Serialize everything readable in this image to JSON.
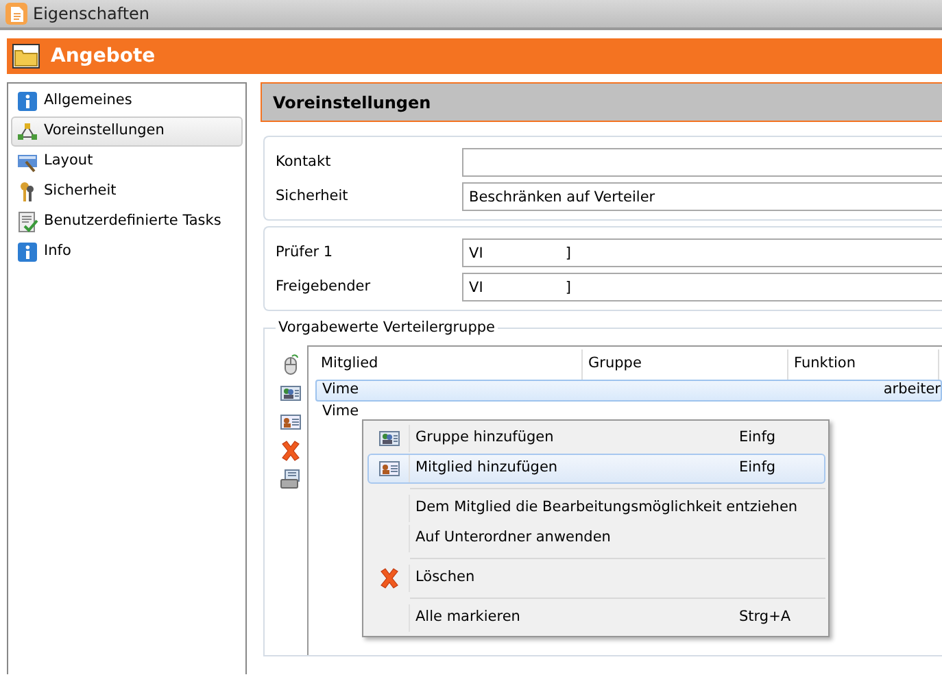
{
  "window": {
    "title": "Eigenschaften"
  },
  "header": {
    "title": "Angebote"
  },
  "sidebar": {
    "items": [
      {
        "label": "Allgemeines",
        "selected": false
      },
      {
        "label": "Voreinstellungen",
        "selected": true
      },
      {
        "label": "Layout",
        "selected": false
      },
      {
        "label": "Sicherheit",
        "selected": false
      },
      {
        "label": "Benutzerdefinierte Tasks",
        "selected": false
      },
      {
        "label": "Info",
        "selected": false
      }
    ]
  },
  "panel": {
    "title": "Voreinstellungen",
    "groups": [
      {
        "fields": [
          {
            "label": "Kontakt"
          },
          {
            "label": "Sicherheit",
            "value": "Beschränken auf Verteiler"
          }
        ]
      },
      {
        "fields": [
          {
            "label": "Prüfer 1",
            "value": "VI                  ]"
          },
          {
            "label": "Freigebender",
            "value": "VI                  ]"
          }
        ]
      }
    ],
    "distribution": {
      "legend": "Vorgabewerte Verteilergruppe",
      "table": {
        "columns": [
          "Mitglied",
          "Gruppe",
          "Funktion"
        ],
        "rows": [
          {
            "selected": true,
            "cells": [
              "Vime",
              "",
              "arbeiter"
            ]
          },
          {
            "selected": false,
            "cells": [
              "Vime",
              "",
              ""
            ]
          }
        ]
      }
    }
  },
  "context_menu": {
    "sections": [
      [
        {
          "label": "Gruppe hinzufügen",
          "shortcut": "Einfg",
          "selected": false
        },
        {
          "label": "Mitglied hinzufügen",
          "shortcut": "Einfg",
          "selected": true
        }
      ],
      [
        {
          "label": "Dem Mitglied die Bearbeitungsmöglichkeit entziehen",
          "selected": false
        },
        {
          "label": "Auf Unterordner anwenden",
          "selected": false
        }
      ],
      [
        {
          "label": "Löschen",
          "selected": false
        }
      ],
      [
        {
          "label": "Alle markieren",
          "shortcut": "Strg+A",
          "selected": false
        }
      ]
    ]
  }
}
